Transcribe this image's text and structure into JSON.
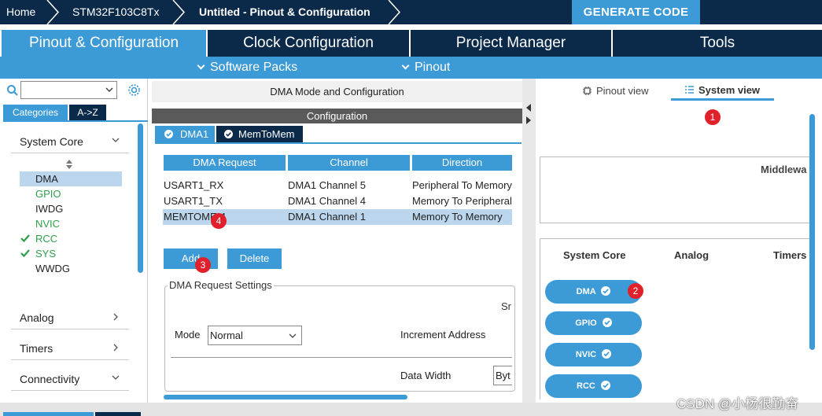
{
  "breadcrumb": {
    "home": "Home",
    "device": "STM32F103C8Tx",
    "project": "Untitled - Pinout & Configuration"
  },
  "generate_code": "GENERATE CODE",
  "main_tabs": [
    {
      "label": "Pinout & Configuration"
    },
    {
      "label": "Clock Configuration"
    },
    {
      "label": "Project Manager"
    },
    {
      "label": "Tools"
    }
  ],
  "subbar": {
    "software_packs": "Software Packs",
    "pinout": "Pinout"
  },
  "left": {
    "tab_categories": "Categories",
    "tab_az": "A->Z",
    "system_core": "System Core",
    "peripherals": [
      {
        "label": "DMA",
        "state": "selected"
      },
      {
        "label": "GPIO",
        "state": "green"
      },
      {
        "label": "IWDG",
        "state": "normal"
      },
      {
        "label": "NVIC",
        "state": "green"
      },
      {
        "label": "RCC",
        "state": "checked"
      },
      {
        "label": "SYS",
        "state": "checked"
      },
      {
        "label": "WWDG",
        "state": "normal"
      }
    ],
    "analog": "Analog",
    "timers": "Timers",
    "connectivity": "Connectivity"
  },
  "middle": {
    "title": "DMA Mode and Configuration",
    "configuration": "Configuration",
    "subtabs": [
      {
        "label": "DMA1"
      },
      {
        "label": "MemToMem"
      }
    ],
    "columns": [
      "DMA Request",
      "Channel",
      "Direction"
    ],
    "rows": [
      [
        "USART1_RX",
        "DMA1 Channel 5",
        "Peripheral To Memory"
      ],
      [
        "USART1_TX",
        "DMA1 Channel 4",
        "Memory To Peripheral"
      ],
      [
        "MEMTOMEM",
        "DMA1 Channel 1",
        "Memory To Memory"
      ]
    ],
    "add": "Add",
    "delete": "Delete",
    "settings_legend": "DMA Request Settings",
    "src": "Sr",
    "mode_label": "Mode",
    "mode_value": "Normal",
    "increment_address": "Increment Address",
    "data_width": "Data Width",
    "data_width_value": "Byt"
  },
  "right": {
    "pinout_view": "Pinout view",
    "system_view": "System view",
    "middleware": "Middlewa",
    "columns": [
      "System Core",
      "Analog",
      "Timers"
    ],
    "capsules": [
      "DMA",
      "GPIO",
      "NVIC",
      "RCC"
    ]
  },
  "badges": [
    "1",
    "2",
    "3",
    "4"
  ],
  "watermark": "CSDN @小杨很勤奋",
  "colors": {
    "accent": "#3c9ad6",
    "navy": "#0b2a4a",
    "badge": "#e0202a",
    "check_green": "#2e9e4a"
  }
}
